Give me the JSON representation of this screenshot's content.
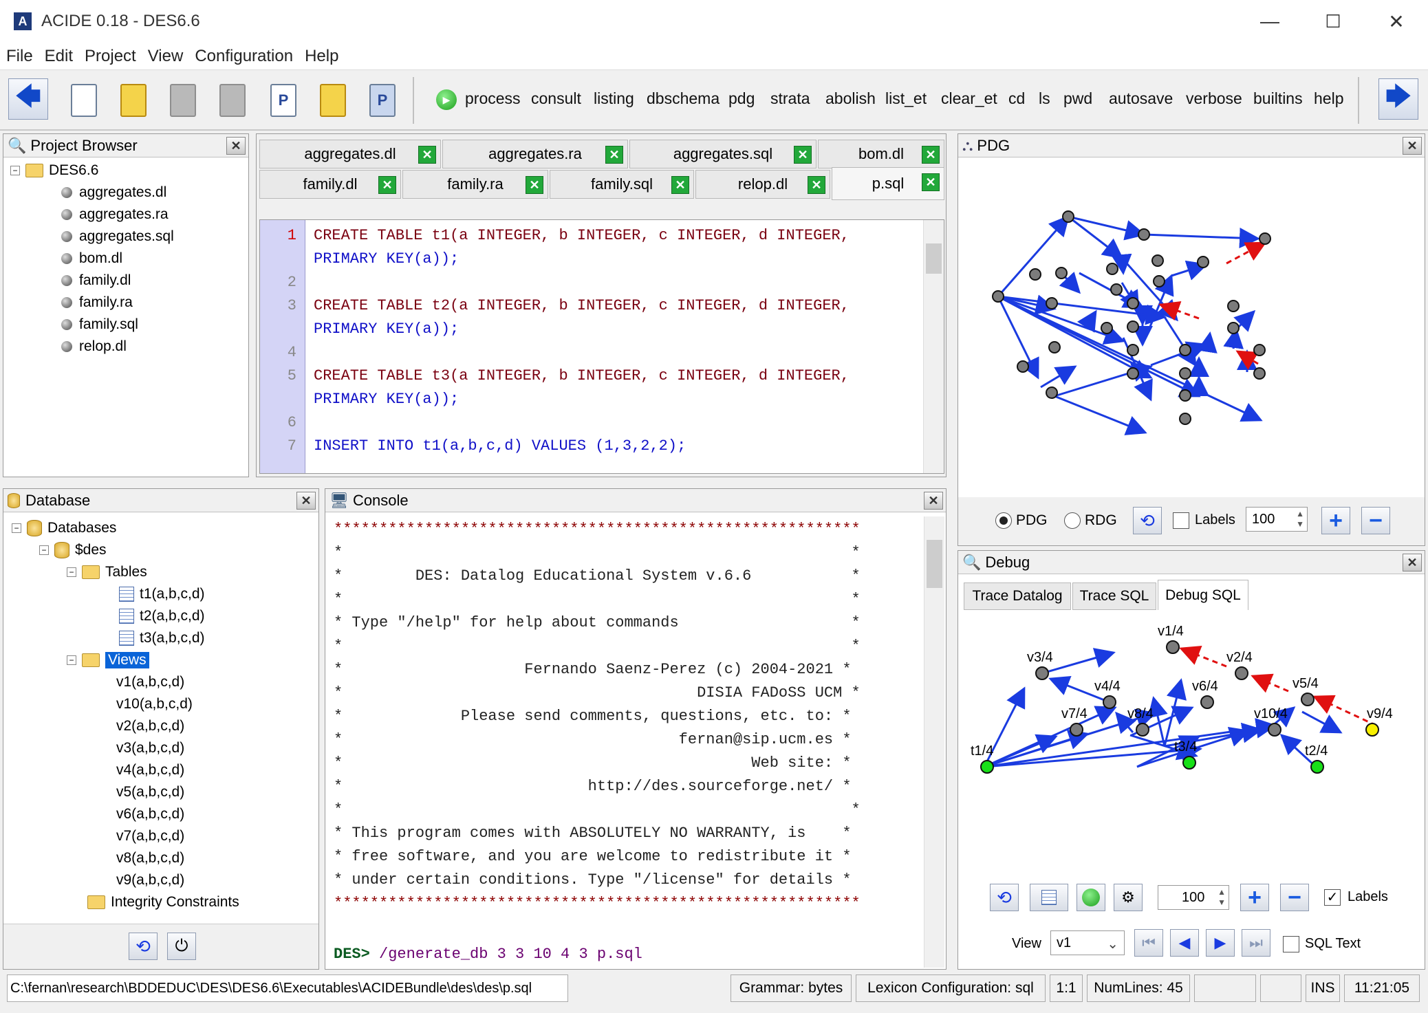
{
  "window": {
    "title": "ACIDE 0.18 - DES6.6",
    "min": "—",
    "max": "☐",
    "close": "✕"
  },
  "menu": [
    "File",
    "Edit",
    "Project",
    "View",
    "Configuration",
    "Help"
  ],
  "toolbar": {
    "commands": [
      "process",
      "consult",
      "listing",
      "dbschema",
      "pdg",
      "strata",
      "abolish",
      "list_et",
      "clear_et",
      "cd",
      "ls",
      "pwd",
      "autosave",
      "verbose",
      "builtins",
      "help"
    ]
  },
  "project_browser": {
    "title": "Project Browser",
    "root": "DES6.6",
    "files": [
      "aggregates.dl",
      "aggregates.ra",
      "aggregates.sql",
      "bom.dl",
      "family.dl",
      "family.ra",
      "family.sql",
      "relop.dl"
    ]
  },
  "editor": {
    "tabs_row1": [
      "aggregates.dl",
      "aggregates.ra",
      "aggregates.sql",
      "bom.dl"
    ],
    "tabs_row2": [
      "family.dl",
      "family.ra",
      "family.sql",
      "relop.dl",
      "p.sql"
    ],
    "line_numbers": [
      "1",
      "",
      "2",
      "3",
      "",
      "4",
      "5",
      "",
      "6",
      "7"
    ],
    "lines": [
      [
        "CREATE TABLE t1(a INTEGER, b INTEGER, c INTEGER, d INTEGER,",
        "PRIMARY KEY(a));"
      ],
      [
        "CREATE TABLE t2(a INTEGER, b INTEGER, c INTEGER, d INTEGER,",
        "PRIMARY KEY(a));"
      ],
      [
        "CREATE TABLE t3(a INTEGER, b INTEGER, c INTEGER, d INTEGER,",
        "PRIMARY KEY(a));"
      ],
      [
        "INSERT INTO t1(a,b,c,d) VALUES (1,3,2,2);"
      ]
    ]
  },
  "pdg": {
    "title": "PDG",
    "radio_pdg": "PDG",
    "radio_rdg": "RDG",
    "labels": "Labels",
    "zoom": "100"
  },
  "database": {
    "title": "Database",
    "root": "Databases",
    "db": "$des",
    "tables_label": "Tables",
    "tables": [
      "t1(a,b,c,d)",
      "t2(a,b,c,d)",
      "t3(a,b,c,d)"
    ],
    "views_label": "Views",
    "views": [
      "v1(a,b,c,d)",
      "v10(a,b,c,d)",
      "v2(a,b,c,d)",
      "v3(a,b,c,d)",
      "v4(a,b,c,d)",
      "v5(a,b,c,d)",
      "v6(a,b,c,d)",
      "v7(a,b,c,d)",
      "v8(a,b,c,d)",
      "v9(a,b,c,d)"
    ],
    "constraints": "Integrity Constraints"
  },
  "console": {
    "title": "Console",
    "lines": [
      "**********************************************************",
      "*                                                        *",
      "*        DES: Datalog Educational System v.6.6           *",
      "*                                                        *",
      "* Type \"/help\" for help about commands                   *",
      "*                                                        *",
      "*                    Fernando Saenz-Perez (c) 2004-2021 *",
      "*                                       DISIA FADoSS UCM *",
      "*             Please send comments, questions, etc. to: *",
      "*                                     fernan@sip.ucm.es *",
      "*                                             Web site: *",
      "*                           http://des.sourceforge.net/ *",
      "*                                                        *",
      "* This program comes with ABSOLUTELY NO WARRANTY, is    *",
      "* free software, and you are welcome to redistribute it *",
      "* under certain conditions. Type \"/license\" for details *",
      "**********************************************************"
    ],
    "prompt": "DES>",
    "command": "/generate_db 3 3 10 4 3 p.sql"
  },
  "debug": {
    "title": "Debug",
    "tabs": [
      "Trace Datalog",
      "Trace SQL",
      "Debug SQL"
    ],
    "nodes": [
      "v1/4",
      "v2/4",
      "v3/4",
      "v4/4",
      "v5/4",
      "v6/4",
      "v7/4",
      "v8/4",
      "v9/4",
      "v10/4",
      "t1/4",
      "t2/4",
      "t3/4"
    ],
    "zoom": "100",
    "labels": "Labels",
    "view_label": "View",
    "view_value": "v1",
    "sql_text": "SQL Text"
  },
  "status": {
    "path": "C:\\fernan\\research\\BDDEDUC\\DES\\DES6.6\\Executables\\ACIDEBundle\\des\\des\\p.sql",
    "grammar": "Grammar: bytes",
    "lexicon": "Lexicon Configuration: sql",
    "pos": "1:1",
    "numlines": "NumLines: 45",
    "mode": "INS",
    "time": "11:21:05"
  },
  "colors": {
    "accent_blue": "#1a3be0",
    "edge_red": "#e01010",
    "selection": "#0a64d8"
  }
}
